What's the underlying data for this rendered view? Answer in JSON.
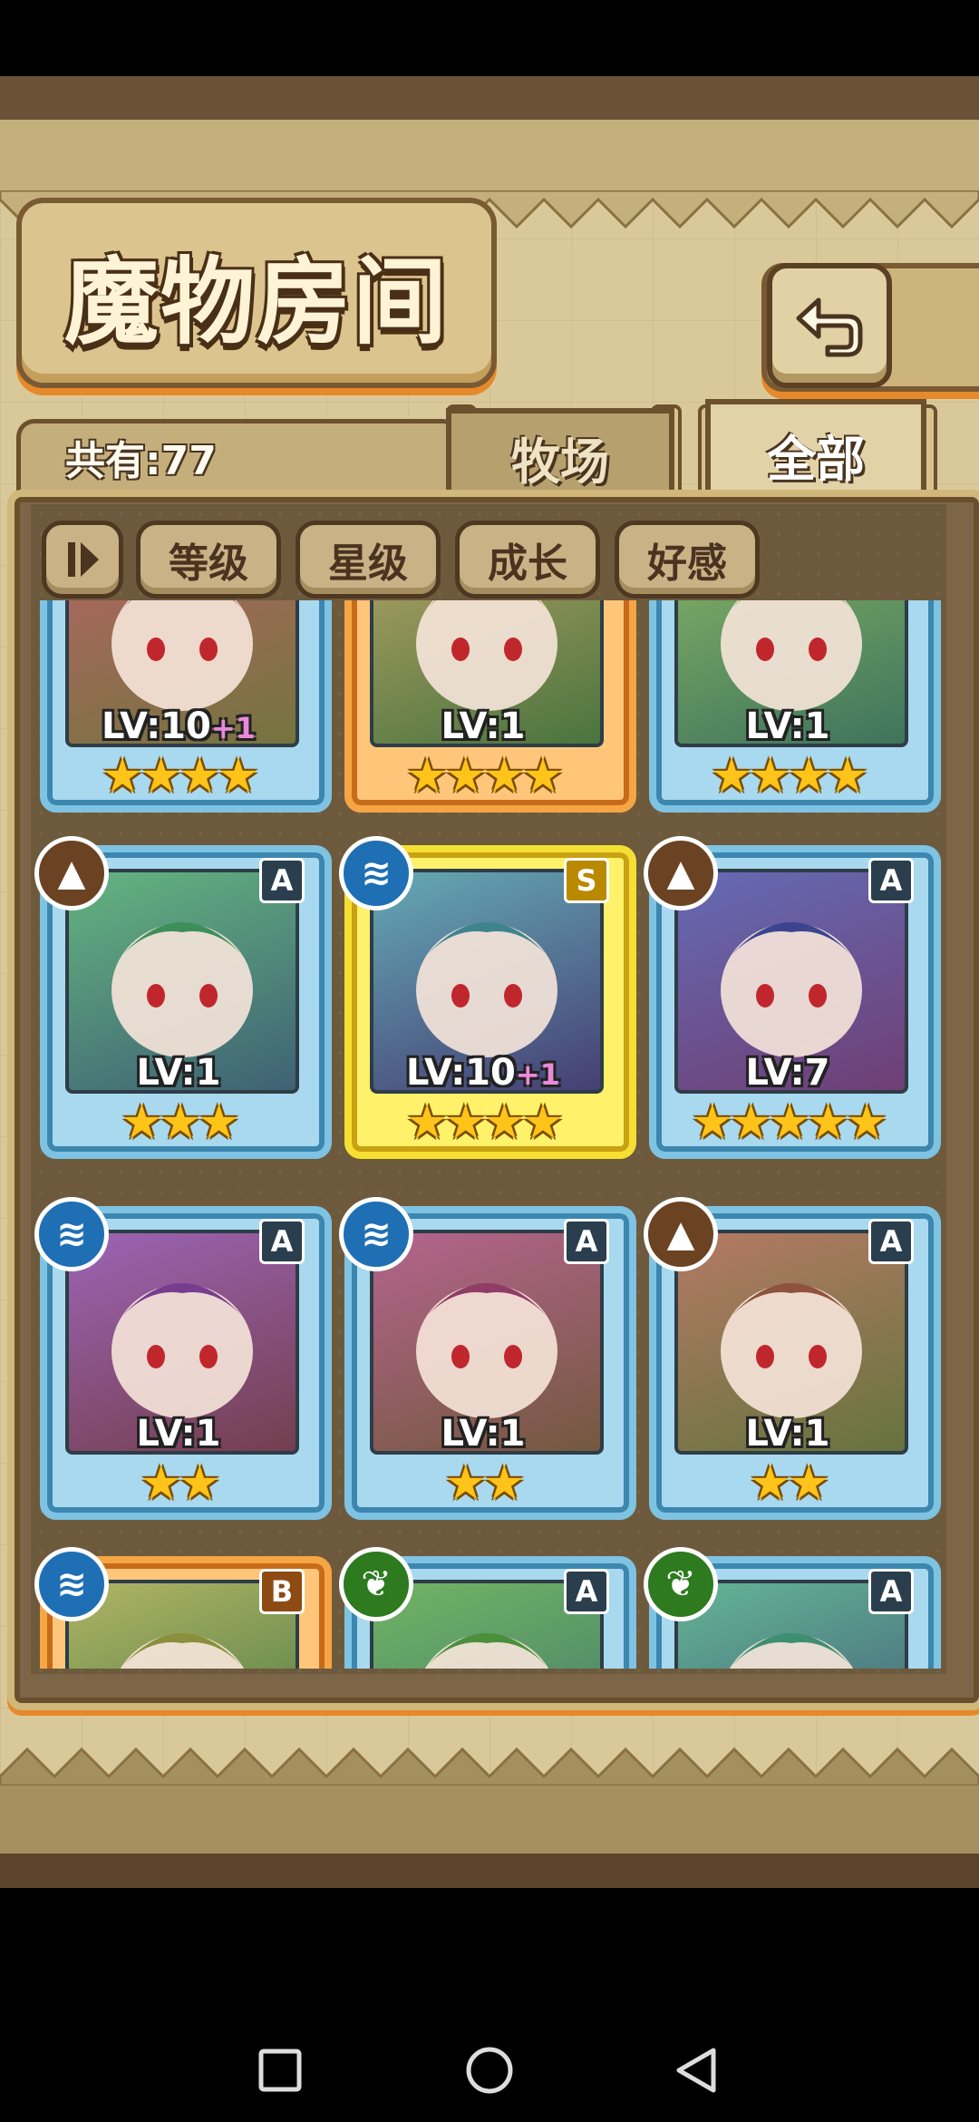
{
  "header": {
    "title": "魔物房间",
    "count_text": "共有:77"
  },
  "tabs": [
    {
      "label": "牧场"
    },
    {
      "label": "全部"
    }
  ],
  "sort_buttons": [
    {
      "label": "等级"
    },
    {
      "label": "星级"
    },
    {
      "label": "成长"
    },
    {
      "label": "好感"
    }
  ],
  "cards": [
    {
      "level": "LV:10",
      "bonus": "+1",
      "stars": "★★★★",
      "rank": "",
      "element": "",
      "frame": "blue"
    },
    {
      "level": "LV:1",
      "bonus": "",
      "stars": "★★★★",
      "rank": "",
      "element": "",
      "frame": "orange"
    },
    {
      "level": "LV:1",
      "bonus": "",
      "stars": "★★★★",
      "rank": "",
      "element": "",
      "frame": "blue"
    },
    {
      "level": "LV:1",
      "bonus": "",
      "stars": "★★★",
      "rank": "A",
      "element": "earth",
      "frame": "blue"
    },
    {
      "level": "LV:10",
      "bonus": "+1",
      "stars": "★★★★",
      "rank": "S",
      "element": "water",
      "frame": "gold"
    },
    {
      "level": "LV:7",
      "bonus": "",
      "stars": "★★★★★",
      "rank": "A",
      "element": "earth",
      "frame": "blue"
    },
    {
      "level": "LV:1",
      "bonus": "",
      "stars": "★★",
      "rank": "A",
      "element": "water",
      "frame": "blue"
    },
    {
      "level": "LV:1",
      "bonus": "",
      "stars": "★★",
      "rank": "A",
      "element": "water",
      "frame": "blue"
    },
    {
      "level": "LV:1",
      "bonus": "",
      "stars": "★★",
      "rank": "A",
      "element": "earth",
      "frame": "blue"
    },
    {
      "level": "",
      "bonus": "",
      "stars": "",
      "rank": "B",
      "element": "water",
      "frame": "orange"
    },
    {
      "level": "",
      "bonus": "",
      "stars": "",
      "rank": "A",
      "element": "leaf",
      "frame": "blue"
    },
    {
      "level": "",
      "bonus": "",
      "stars": "",
      "rank": "A",
      "element": "leaf",
      "frame": "blue"
    }
  ],
  "element_icons": {
    "water": "≋",
    "earth": "▲",
    "leaf": "❦"
  },
  "colors": {
    "frame_blue": "#7fc3e2",
    "frame_gold": "#f5df32",
    "frame_orange": "#f6a545",
    "star": "#ffc41a",
    "bonus": "#e98ad9"
  },
  "system_nav": [
    "recent-apps",
    "home",
    "back"
  ]
}
